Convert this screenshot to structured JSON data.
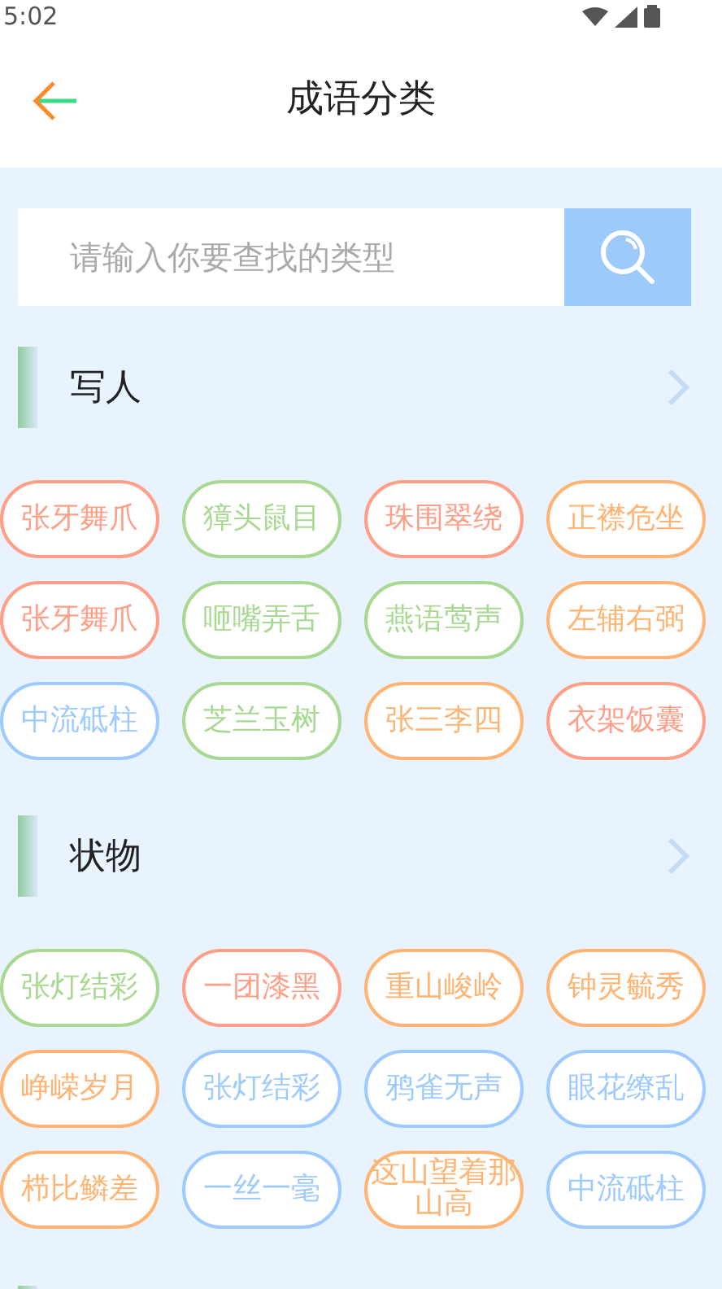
{
  "status_bar": {
    "time": "5:02"
  },
  "header": {
    "title": "成语分类"
  },
  "search": {
    "placeholder": "请输入你要查找的类型"
  },
  "sections": [
    {
      "title": "写人",
      "tags": [
        {
          "text": "张牙舞爪",
          "color": "#ff9f88"
        },
        {
          "text": "獐头鼠目",
          "color": "#a9d892"
        },
        {
          "text": "珠围翠绕",
          "color": "#ff9f88"
        },
        {
          "text": "正襟危坐",
          "color": "#ffb473"
        },
        {
          "text": "张牙舞爪",
          "color": "#ff9f88"
        },
        {
          "text": "咂嘴弄舌",
          "color": "#a9d892"
        },
        {
          "text": "燕语莺声",
          "color": "#a9d892"
        },
        {
          "text": "左辅右弼",
          "color": "#ffb473"
        },
        {
          "text": "中流砥柱",
          "color": "#9ecbff"
        },
        {
          "text": "芝兰玉树",
          "color": "#a9d892"
        },
        {
          "text": "张三李四",
          "color": "#ffb473"
        },
        {
          "text": "衣架饭囊",
          "color": "#ff9f88"
        }
      ]
    },
    {
      "title": "状物",
      "tags": [
        {
          "text": "张灯结彩",
          "color": "#a9d892"
        },
        {
          "text": "一团漆黑",
          "color": "#ff9f88"
        },
        {
          "text": "重山峻岭",
          "color": "#ffb473"
        },
        {
          "text": "钟灵毓秀",
          "color": "#ffb473"
        },
        {
          "text": "峥嵘岁月",
          "color": "#ffb473"
        },
        {
          "text": "张灯结彩",
          "color": "#9ecbff"
        },
        {
          "text": "鸦雀无声",
          "color": "#9ecbff"
        },
        {
          "text": "眼花缭乱",
          "color": "#9ecbff"
        },
        {
          "text": "栉比鳞差",
          "color": "#ffb473"
        },
        {
          "text": "一丝一毫",
          "color": "#9ecbff"
        },
        {
          "text": "这山望着那山高",
          "color": "#ffb473"
        },
        {
          "text": "中流砥柱",
          "color": "#9ecbff"
        }
      ]
    }
  ]
}
